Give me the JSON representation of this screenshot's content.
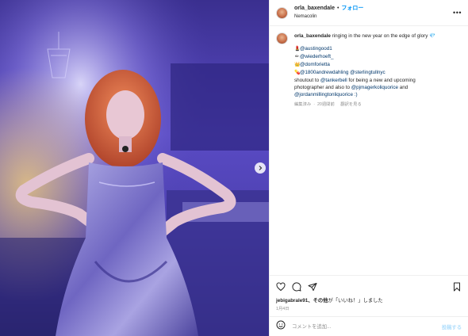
{
  "post": {
    "username": "orla_baxendale",
    "separator": "•",
    "follow_label": "フォロー",
    "location": "Nemacolin",
    "caption_text": "ringing in the new year on the edge of glory 💎",
    "lines": [
      {
        "icon": "lipstick-emoji",
        "glyph": "💄",
        "parts": [
          {
            "t": "@austingood1",
            "m": true
          }
        ]
      },
      {
        "icon": "brush-emoji",
        "glyph": "✏",
        "parts": [
          {
            "t": "@wiederhoeft_",
            "m": true
          }
        ]
      },
      {
        "icon": "crown-emoji",
        "glyph": "👑",
        "parts": [
          {
            "t": "@domforietta",
            "m": true
          }
        ]
      },
      {
        "icon": "pill-emoji",
        "glyph": "💊",
        "parts": [
          {
            "t": "@1800andrewdahling",
            "m": true
          },
          {
            "t": " ",
            "m": false
          },
          {
            "t": "@sterlingtullnyc",
            "m": true
          }
        ]
      },
      {
        "icon": "",
        "glyph": "",
        "parts": [
          {
            "t": "shoutout to ",
            "m": false
          },
          {
            "t": "@tankerbell",
            "m": true
          },
          {
            "t": " for being a new and upcoming",
            "m": false
          }
        ]
      },
      {
        "icon": "",
        "glyph": "",
        "parts": [
          {
            "t": "photographer and also to ",
            "m": false
          },
          {
            "t": "@pjmagerkoliquorice",
            "m": true
          },
          {
            "t": " and",
            "m": false
          }
        ]
      },
      {
        "icon": "",
        "glyph": "",
        "parts": [
          {
            "t": "@jordanmillingtonliquorice :)",
            "m": true
          }
        ]
      }
    ],
    "edited": "編集済み",
    "age": "20週間前",
    "see_translation": "翻訳を見る",
    "liked_by_user": "jebigabrale91",
    "liked_suffix": "、その他",
    "liked_tail": "が「いいね！」しました",
    "date": "1月4日",
    "comment_placeholder": "コメントを追加...",
    "post_label": "投稿する"
  },
  "icons": {
    "more": "more-options-icon",
    "like": "heart-icon",
    "comment": "comment-icon",
    "share": "share-icon",
    "save": "bookmark-icon",
    "emoji": "emoji-icon",
    "next": "chevron-right-icon"
  },
  "colors": {
    "link": "#0095f6",
    "mention": "#00376b",
    "muted": "#8e8e8e",
    "post_disabled": "#b2dffc"
  }
}
